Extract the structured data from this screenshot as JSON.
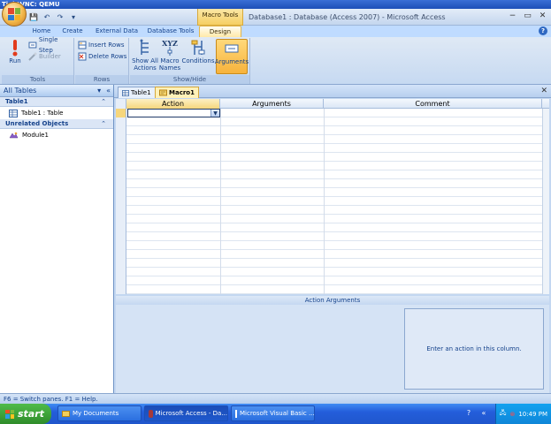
{
  "vnc": {
    "title": "TightVNC: QEMU"
  },
  "window": {
    "context_tab_group": "Macro Tools",
    "title": "Database1 : Database (Access 2007) - Microsoft Access",
    "controls": {
      "minimize": "−",
      "restore": "▭",
      "close": "✕"
    },
    "qat": {
      "save": "💾",
      "undo": "↶",
      "redo": "↷",
      "customize": "▾"
    }
  },
  "ribbon_tabs": [
    {
      "label": "Home"
    },
    {
      "label": "Create"
    },
    {
      "label": "External Data"
    },
    {
      "label": "Database Tools"
    },
    {
      "label": "Design"
    }
  ],
  "ribbon": {
    "tools": {
      "label": "Tools",
      "run": "Run",
      "single_step": "Single Step",
      "builder": "Builder"
    },
    "rows": {
      "label": "Rows",
      "insert": "Insert Rows",
      "delete": "Delete Rows"
    },
    "show_hide": {
      "label": "Show/Hide",
      "show_all_actions": "Show All Actions",
      "macro_names": "Macro Names",
      "xyz": "XYZ",
      "conditions": "Conditions",
      "arguments": "Arguments"
    }
  },
  "nav": {
    "header": "All Tables",
    "groups": [
      {
        "title": "Table1",
        "items": [
          {
            "label": "Table1 : Table"
          }
        ]
      },
      {
        "title": "Unrelated Objects",
        "items": [
          {
            "label": "Module1"
          }
        ]
      }
    ]
  },
  "doc_tabs": [
    {
      "label": "Table1"
    },
    {
      "label": "Macro1"
    }
  ],
  "grid": {
    "columns": [
      "Action",
      "Arguments",
      "Comment"
    ]
  },
  "action_arguments": {
    "label": "Action Arguments",
    "help": "Enter an action in this column."
  },
  "status": {
    "text": "F6 = Switch panes.  F1 = Help."
  },
  "taskbar": {
    "start": "start",
    "buttons": [
      {
        "label": "My Documents"
      },
      {
        "label": "Microsoft Access - Da..."
      },
      {
        "label": "Microsoft Visual Basic ..."
      }
    ],
    "help": "?",
    "time": "10:49 PM"
  },
  "colors": {
    "ribbon_bg": "#c6d9f1",
    "context_tab": "#f6cf63",
    "taskbar": "#245edb",
    "start": "#2f8c2a"
  }
}
